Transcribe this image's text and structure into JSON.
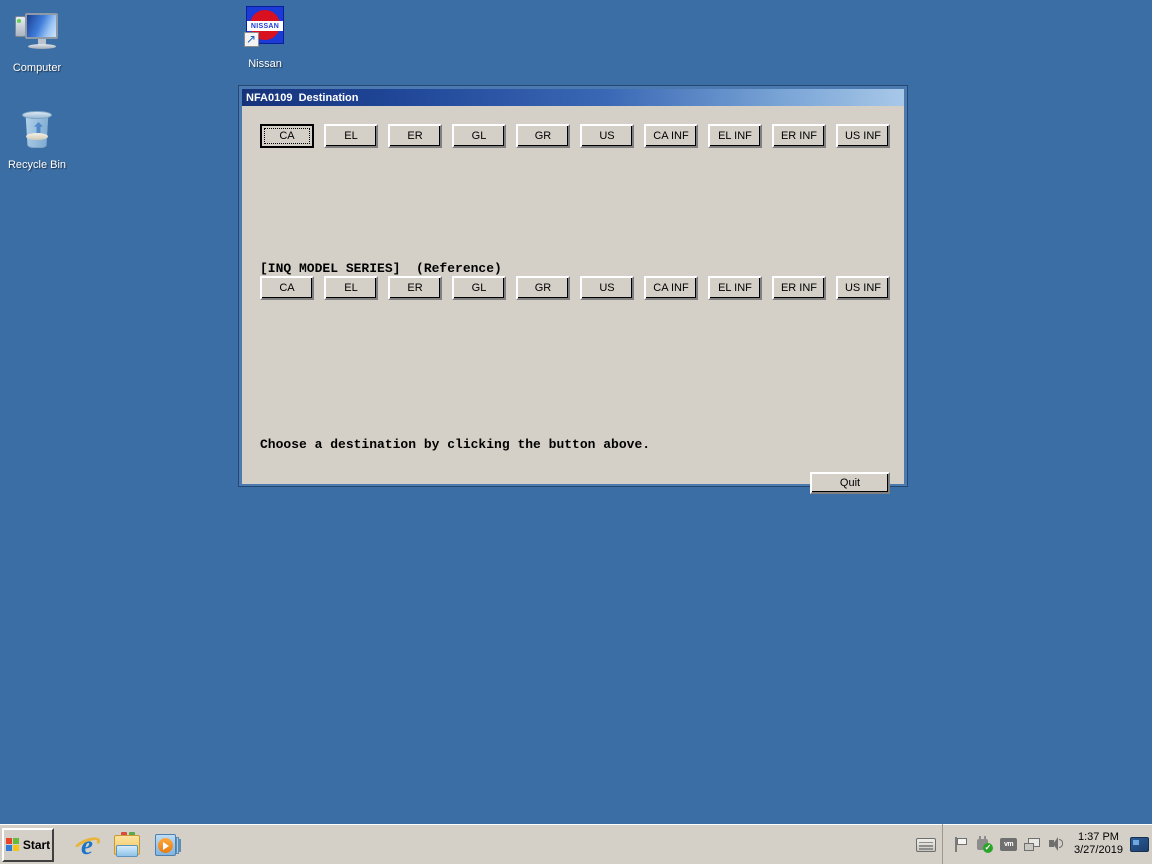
{
  "desktop": {
    "background_color": "#3a6ea5",
    "icons": [
      {
        "label": "Computer",
        "icon": "computer-monitor-icon"
      },
      {
        "label": "Recycle Bin",
        "icon": "recycle-bin-icon"
      },
      {
        "label": "Nissan",
        "icon": "nissan-shortcut-icon"
      }
    ]
  },
  "window": {
    "title": "NFA0109  Destination",
    "title_code": "NFA0109",
    "title_name": "Destination",
    "titlebar_gradient_start": "#16337a",
    "titlebar_gradient_end": "#a8c8e8",
    "client_color": "#d4d0c8",
    "frame_color": "#4a7ab0",
    "destination_buttons": [
      {
        "label": "CA",
        "focused": true
      },
      {
        "label": "EL",
        "focused": false
      },
      {
        "label": "ER",
        "focused": false
      },
      {
        "label": "GL",
        "focused": false
      },
      {
        "label": "GR",
        "focused": false
      },
      {
        "label": "US",
        "focused": false
      },
      {
        "label": "CA INF",
        "focused": false
      },
      {
        "label": "EL INF",
        "focused": false
      },
      {
        "label": "ER INF",
        "focused": false
      },
      {
        "label": "US INF",
        "focused": false
      }
    ],
    "series_label": "[INQ MODEL SERIES]  (Reference)",
    "series_buttons": [
      {
        "label": "CA"
      },
      {
        "label": "EL"
      },
      {
        "label": "ER"
      },
      {
        "label": "GL"
      },
      {
        "label": "GR"
      },
      {
        "label": "US"
      },
      {
        "label": "CA INF"
      },
      {
        "label": "EL INF"
      },
      {
        "label": "ER INF"
      },
      {
        "label": "US INF"
      }
    ],
    "instruction": "Choose a destination by clicking the button above.",
    "quit_label": "Quit"
  },
  "taskbar": {
    "start_label": "Start",
    "quick_launch": [
      {
        "name": "internet-explorer-icon"
      },
      {
        "name": "file-explorer-icon"
      },
      {
        "name": "media-player-icon"
      }
    ],
    "tray": [
      {
        "name": "flag-icon"
      },
      {
        "name": "security-shield-check-icon"
      },
      {
        "name": "vm-icon",
        "text": "vm"
      },
      {
        "name": "network-icon"
      },
      {
        "name": "volume-icon"
      }
    ],
    "clock_time": "1:37 PM",
    "clock_date": "3/27/2019"
  }
}
